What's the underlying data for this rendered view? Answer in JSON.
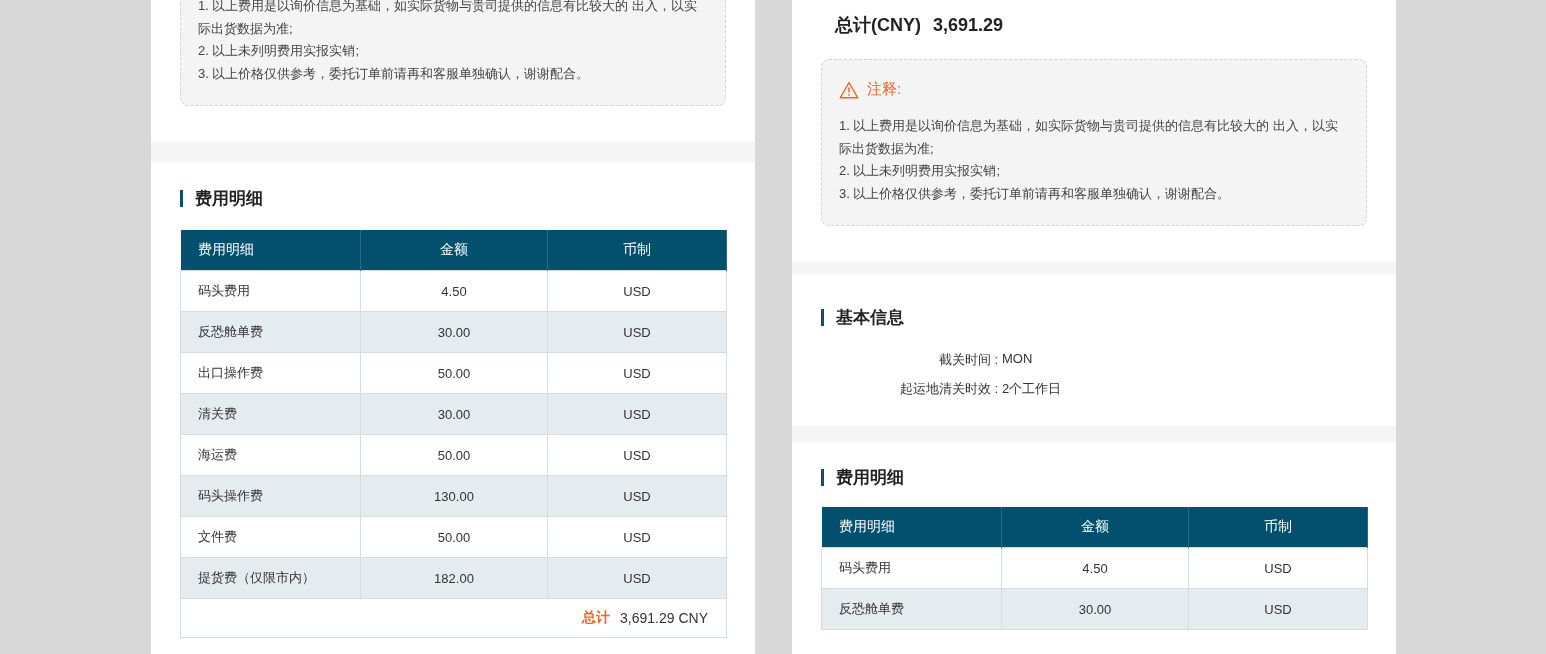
{
  "left_panel": {
    "notes": {
      "items": [
        "1. 以上费用是以询价信息为基础，如实际货物与贵司提供的信息有比较大的    出入，以实际出货数据为准;",
        "2. 以上未列明费用实报实销;",
        "3. 以上价格仅供参考，委托订单前请再和客服单独确认，谢谢配合。"
      ]
    },
    "fee_section": {
      "title": "费用明细",
      "table": {
        "columns": [
          "费用明细",
          "金额",
          "币制"
        ],
        "rows": [
          {
            "item": "码头费用",
            "amount": "4.50",
            "currency": "USD"
          },
          {
            "item": "反恐舱单费",
            "amount": "30.00",
            "currency": "USD"
          },
          {
            "item": "出口操作费",
            "amount": "50.00",
            "currency": "USD"
          },
          {
            "item": "清关费",
            "amount": "30.00",
            "currency": "USD"
          },
          {
            "item": "海运费",
            "amount": "50.00",
            "currency": "USD"
          },
          {
            "item": "码头操作费",
            "amount": "130.00",
            "currency": "USD"
          },
          {
            "item": "文件费",
            "amount": "50.00",
            "currency": "USD"
          },
          {
            "item": "提货费（仅限市内）",
            "amount": "182.00",
            "currency": "USD"
          }
        ],
        "total": {
          "label": "总计",
          "value": "3,691.29 CNY"
        }
      }
    }
  },
  "right_panel": {
    "total": {
      "label": "总计(CNY)",
      "value": "3,691.29"
    },
    "notes": {
      "title": "注释:",
      "items": [
        "1. 以上费用是以询价信息为基础，如实际货物与贵司提供的信息有比较大的    出入，以实际出货数据为准;",
        "2. 以上未列明费用实报实销;",
        "3. 以上价格仅供参考，委托订单前请再和客服单独确认，谢谢配合。"
      ]
    },
    "basic_info": {
      "title": "基本信息",
      "fields": [
        {
          "label": "截关时间 :",
          "value": "MON"
        },
        {
          "label": "起运地清关时效 :",
          "value": "2个工作日"
        }
      ]
    },
    "fee_section": {
      "title": "费用明细",
      "table": {
        "columns": [
          "费用明细",
          "金额",
          "币制"
        ],
        "rows": [
          {
            "item": "码头费用",
            "amount": "4.50",
            "currency": "USD"
          },
          {
            "item": "反恐舱单费",
            "amount": "30.00",
            "currency": "USD"
          }
        ]
      }
    }
  }
}
